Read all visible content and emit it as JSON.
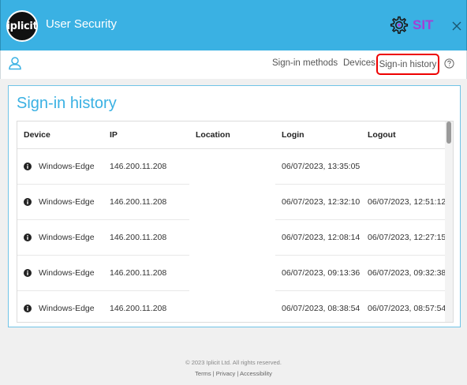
{
  "header": {
    "logo_text": "iplicit",
    "title": "User Security",
    "env_badge": "SIT",
    "env_color": "#a43fd6",
    "accent": "#3ab1e3"
  },
  "nav": {
    "items": [
      {
        "label": "Sign-in methods"
      },
      {
        "label": "Devices"
      },
      {
        "label": "Sign-in history"
      }
    ]
  },
  "main": {
    "title": "Sign-in history",
    "columns": [
      "Device",
      "IP",
      "Location",
      "Login",
      "Logout"
    ],
    "rows": [
      {
        "device": "Windows-Edge",
        "ip": "146.200.11.208",
        "location": "",
        "login": "06/07/2023, 13:35:05",
        "logout": ""
      },
      {
        "device": "Windows-Edge",
        "ip": "146.200.11.208",
        "location": "",
        "login": "06/07/2023, 12:32:10",
        "logout": "06/07/2023, 12:51:12"
      },
      {
        "device": "Windows-Edge",
        "ip": "146.200.11.208",
        "location": "",
        "login": "06/07/2023, 12:08:14",
        "logout": "06/07/2023, 12:27:15"
      },
      {
        "device": "Windows-Edge",
        "ip": "146.200.11.208",
        "location": "",
        "login": "06/07/2023, 09:13:36",
        "logout": "06/07/2023, 09:32:38"
      },
      {
        "device": "Windows-Edge",
        "ip": "146.200.11.208",
        "location": "",
        "login": "06/07/2023, 08:38:54",
        "logout": "06/07/2023, 08:57:54"
      }
    ]
  },
  "footer": {
    "copyright": "© 2023 Iplicit Ltd. All rights reserved.",
    "terms": "Terms",
    "privacy": "Privacy",
    "accessibility": "Accessibility",
    "separator": " | "
  }
}
